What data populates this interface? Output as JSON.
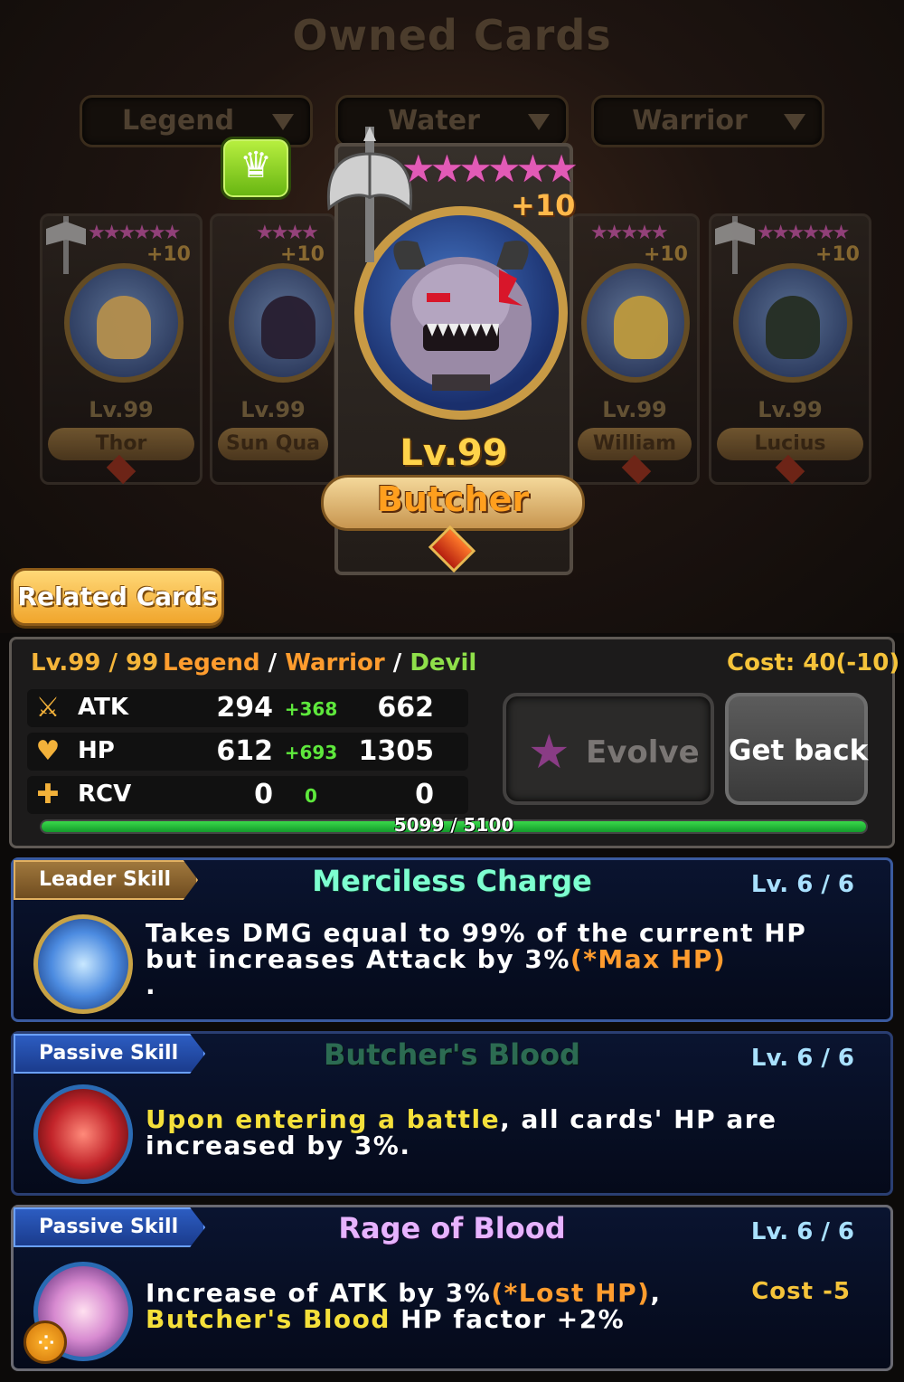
{
  "title": "Owned Cards",
  "filters": [
    {
      "label": "Legend"
    },
    {
      "label": "Water"
    },
    {
      "label": "Warrior"
    }
  ],
  "icons": {
    "crown": "crown-icon",
    "axe": "axe-icon",
    "attack": "sword-icon",
    "hp": "heart-icon",
    "rcv": "cross-icon",
    "evolve": "star-icon",
    "menu": "grid-menu-icon"
  },
  "side_cards": [
    {
      "level": "Lv.99",
      "name": "Thor",
      "plus": "+10"
    },
    {
      "level": "Lv.99",
      "name": "Sun Qua",
      "plus": "+10"
    },
    {
      "level": "Lv.99",
      "name": "William",
      "plus": "+10"
    },
    {
      "level": "Lv.99",
      "name": "Lucius",
      "plus": "+10"
    }
  ],
  "main_card": {
    "stars": 6,
    "plus": "+10",
    "level": "Lv.99",
    "name": "Butcher"
  },
  "related_button": "Related Cards",
  "stats": {
    "level": "Lv.99 / 99",
    "rarity": "Legend",
    "sep1": " / ",
    "class": "Warrior",
    "sep2": " / ",
    "type": "Devil",
    "cost": "Cost: 40(-10)",
    "rows": [
      {
        "label": "ATK",
        "base": "294",
        "bonus": "+368",
        "total": "662"
      },
      {
        "label": "HP",
        "base": "612",
        "bonus": "+693",
        "total": "1305"
      },
      {
        "label": "RCV",
        "base": "0",
        "bonus": "0",
        "total": "0"
      }
    ],
    "exp_text": "5099 / 5100",
    "exp_fraction": 0.9998
  },
  "buttons": {
    "evolve": "Evolve",
    "get_back": "Get back"
  },
  "skills": [
    {
      "tag": "Leader Skill",
      "title": "Merciless Charge",
      "level": "Lv. 6 / 6",
      "desc_a": "Takes DMG equal to 99% of the current HP but increases Attack by 3%",
      "desc_hl": "(*Max HP)",
      "desc_b": "."
    },
    {
      "tag": "Passive Skill",
      "title": "Butcher's Blood",
      "level": "Lv. 6 / 6",
      "desc_hl": "Upon entering a battle",
      "desc_a": ", all cards' HP are increased by 3%."
    },
    {
      "tag": "Passive Skill",
      "title": "Rage of Blood",
      "level": "Lv. 6 / 6",
      "extra": "Cost -5",
      "desc_a": "Increase of ATK by 3%",
      "desc_hl1": "(*Lost HP)",
      "desc_b": ", ",
      "desc_hl2": "Butcher's Blood",
      "desc_c": " HP factor +2%"
    }
  ],
  "colors": {
    "gold": "#f5b53a",
    "legend_orange": "#ff9c2e",
    "warrior_orange": "#ff9c2e",
    "devil_green": "#8fe04a",
    "bonus_green": "#5ee83c",
    "skill_title_leader": "#7dffd0",
    "skill_title_butcher": "#2c6b52",
    "skill_title_rage": "#e7b3ff"
  }
}
